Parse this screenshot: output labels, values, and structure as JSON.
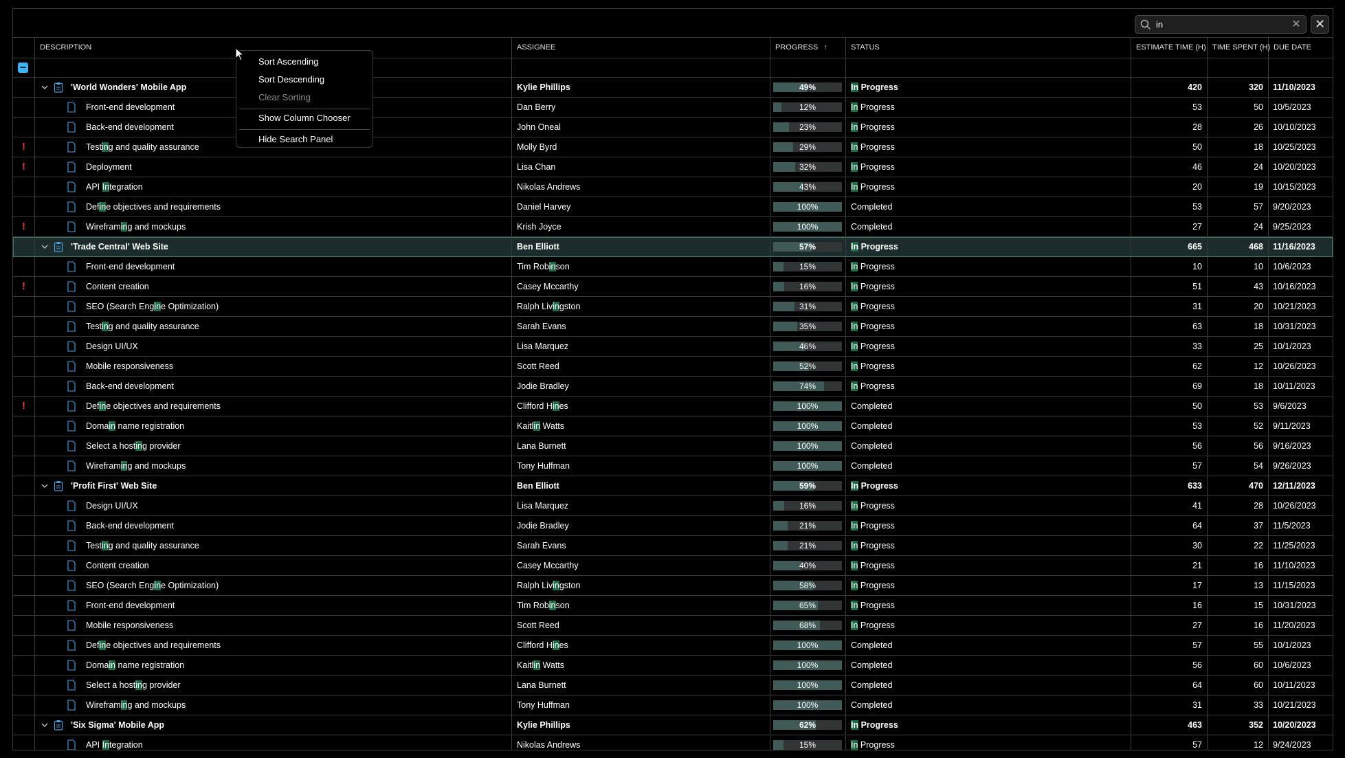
{
  "search": {
    "value": "in",
    "highlight": "in"
  },
  "columns": {
    "description": "DESCRIPTION",
    "assignee": "ASSIGNEE",
    "progress": "PROGRESS",
    "status": "STATUS",
    "estimate": "ESTIMATE TIME (H)",
    "spent": "TIME SPENT (H)",
    "due": "DUE DATE"
  },
  "sort": {
    "column": "progress",
    "direction": "ascending",
    "icon": "arrow-up-icon"
  },
  "context_menu": {
    "sort_ascending": "Sort Ascending",
    "sort_descending": "Sort Descending",
    "clear_sorting": "Clear Sorting",
    "show_column_chooser": "Show Column Chooser",
    "hide_search_panel": "Hide Search Panel"
  },
  "colors": {
    "flag": "#e23a3a",
    "highlight": "#1f6b47",
    "progress_fill": "#3f5a57",
    "select_all": "#3bb3f0"
  },
  "rows": [
    {
      "type": "group",
      "desc": "'World Wonders' Mobile App",
      "assignee": "Kylie Phillips",
      "progress": 49,
      "status": "In Progress",
      "est": "420",
      "spent": "320",
      "due": "11/10/2023"
    },
    {
      "type": "task",
      "desc": "Front-end development",
      "assignee": "Dan Berry",
      "progress": 12,
      "status": "In Progress",
      "est": "53",
      "spent": "50",
      "due": "10/5/2023"
    },
    {
      "type": "task",
      "desc": "Back-end development",
      "assignee": "John Oneal",
      "progress": 23,
      "status": "In Progress",
      "est": "28",
      "spent": "26",
      "due": "10/10/2023"
    },
    {
      "type": "task",
      "flag": true,
      "desc": "Testing and quality assurance",
      "assignee": "Molly Byrd",
      "progress": 29,
      "status": "In Progress",
      "est": "50",
      "spent": "18",
      "due": "10/25/2023"
    },
    {
      "type": "task",
      "flag": true,
      "desc": "Deployment",
      "assignee": "Lisa Chan",
      "progress": 32,
      "status": "In Progress",
      "est": "46",
      "spent": "24",
      "due": "10/20/2023"
    },
    {
      "type": "task",
      "desc": "API Integration",
      "assignee": "Nikolas Andrews",
      "progress": 43,
      "status": "In Progress",
      "est": "20",
      "spent": "19",
      "due": "10/15/2023"
    },
    {
      "type": "task",
      "desc": "Define objectives and requirements",
      "assignee": "Daniel Harvey",
      "progress": 100,
      "status": "Completed",
      "est": "53",
      "spent": "57",
      "due": "9/20/2023"
    },
    {
      "type": "task",
      "flag": true,
      "desc": "Wireframing and mockups",
      "assignee": "Krish Joyce",
      "progress": 100,
      "status": "Completed",
      "est": "27",
      "spent": "24",
      "due": "9/25/2023"
    },
    {
      "type": "group",
      "selected": true,
      "desc": "'Trade Central' Web Site",
      "assignee": "Ben Elliott",
      "progress": 57,
      "status": "In Progress",
      "est": "665",
      "spent": "468",
      "due": "11/16/2023"
    },
    {
      "type": "task",
      "desc": "Front-end development",
      "assignee": "Tim Robinson",
      "progress": 15,
      "status": "In Progress",
      "est": "10",
      "spent": "10",
      "due": "10/6/2023"
    },
    {
      "type": "task",
      "flag": true,
      "desc": "Content creation",
      "assignee": "Casey Mccarthy",
      "progress": 16,
      "status": "In Progress",
      "est": "51",
      "spent": "43",
      "due": "10/16/2023"
    },
    {
      "type": "task",
      "desc": "SEO (Search Engine Optimization)",
      "assignee": "Ralph Livingston",
      "progress": 31,
      "status": "In Progress",
      "est": "31",
      "spent": "20",
      "due": "10/21/2023"
    },
    {
      "type": "task",
      "desc": "Testing and quality assurance",
      "assignee": "Sarah Evans",
      "progress": 35,
      "status": "In Progress",
      "est": "63",
      "spent": "18",
      "due": "10/31/2023"
    },
    {
      "type": "task",
      "desc": "Design UI/UX",
      "assignee": "Lisa Marquez",
      "progress": 46,
      "status": "In Progress",
      "est": "33",
      "spent": "25",
      "due": "10/1/2023"
    },
    {
      "type": "task",
      "desc": "Mobile responsiveness",
      "assignee": "Scott Reed",
      "progress": 52,
      "status": "In Progress",
      "est": "62",
      "spent": "12",
      "due": "10/26/2023"
    },
    {
      "type": "task",
      "desc": "Back-end development",
      "assignee": "Jodie Bradley",
      "progress": 74,
      "status": "In Progress",
      "est": "69",
      "spent": "18",
      "due": "10/11/2023"
    },
    {
      "type": "task",
      "flag": true,
      "desc": "Define objectives and requirements",
      "assignee": "Clifford Hines",
      "progress": 100,
      "status": "Completed",
      "est": "50",
      "spent": "53",
      "due": "9/6/2023"
    },
    {
      "type": "task",
      "desc": "Domain name registration",
      "assignee": "Kaitlin Watts",
      "progress": 100,
      "status": "Completed",
      "est": "53",
      "spent": "52",
      "due": "9/11/2023"
    },
    {
      "type": "task",
      "desc": "Select a hosting provider",
      "assignee": "Lana Burnett",
      "progress": 100,
      "status": "Completed",
      "est": "56",
      "spent": "56",
      "due": "9/16/2023"
    },
    {
      "type": "task",
      "desc": "Wireframing and mockups",
      "assignee": "Tony Huffman",
      "progress": 100,
      "status": "Completed",
      "est": "57",
      "spent": "54",
      "due": "9/26/2023"
    },
    {
      "type": "group",
      "desc": "'Profit First' Web Site",
      "assignee": "Ben Elliott",
      "progress": 59,
      "status": "In Progress",
      "est": "633",
      "spent": "470",
      "due": "12/11/2023"
    },
    {
      "type": "task",
      "desc": "Design UI/UX",
      "assignee": "Lisa Marquez",
      "progress": 16,
      "status": "In Progress",
      "est": "41",
      "spent": "28",
      "due": "10/26/2023"
    },
    {
      "type": "task",
      "desc": "Back-end development",
      "assignee": "Jodie Bradley",
      "progress": 21,
      "status": "In Progress",
      "est": "64",
      "spent": "37",
      "due": "11/5/2023"
    },
    {
      "type": "task",
      "desc": "Testing and quality assurance",
      "assignee": "Sarah Evans",
      "progress": 21,
      "status": "In Progress",
      "est": "30",
      "spent": "22",
      "due": "11/25/2023"
    },
    {
      "type": "task",
      "desc": "Content creation",
      "assignee": "Casey Mccarthy",
      "progress": 40,
      "status": "In Progress",
      "est": "21",
      "spent": "16",
      "due": "11/10/2023"
    },
    {
      "type": "task",
      "desc": "SEO (Search Engine Optimization)",
      "assignee": "Ralph Livingston",
      "progress": 58,
      "status": "In Progress",
      "est": "17",
      "spent": "13",
      "due": "11/15/2023"
    },
    {
      "type": "task",
      "desc": "Front-end development",
      "assignee": "Tim Robinson",
      "progress": 65,
      "status": "In Progress",
      "est": "16",
      "spent": "15",
      "due": "10/31/2023"
    },
    {
      "type": "task",
      "desc": "Mobile responsiveness",
      "assignee": "Scott Reed",
      "progress": 68,
      "status": "In Progress",
      "est": "27",
      "spent": "16",
      "due": "11/20/2023"
    },
    {
      "type": "task",
      "desc": "Define objectives and requirements",
      "assignee": "Clifford Hines",
      "progress": 100,
      "status": "Completed",
      "est": "57",
      "spent": "55",
      "due": "10/1/2023"
    },
    {
      "type": "task",
      "desc": "Domain name registration",
      "assignee": "Kaitlin Watts",
      "progress": 100,
      "status": "Completed",
      "est": "56",
      "spent": "60",
      "due": "10/6/2023"
    },
    {
      "type": "task",
      "desc": "Select a hosting provider",
      "assignee": "Lana Burnett",
      "progress": 100,
      "status": "Completed",
      "est": "64",
      "spent": "60",
      "due": "10/11/2023"
    },
    {
      "type": "task",
      "desc": "Wireframing and mockups",
      "assignee": "Tony Huffman",
      "progress": 100,
      "status": "Completed",
      "est": "31",
      "spent": "33",
      "due": "10/21/2023"
    },
    {
      "type": "group",
      "desc": "'Six Sigma' Mobile App",
      "assignee": "Kylie Phillips",
      "progress": 62,
      "status": "In Progress",
      "est": "463",
      "spent": "352",
      "due": "10/20/2023"
    },
    {
      "type": "task",
      "desc": "API Integration",
      "assignee": "Nikolas Andrews",
      "progress": 15,
      "status": "In Progress",
      "est": "57",
      "spent": "12",
      "due": "9/24/2023"
    }
  ]
}
